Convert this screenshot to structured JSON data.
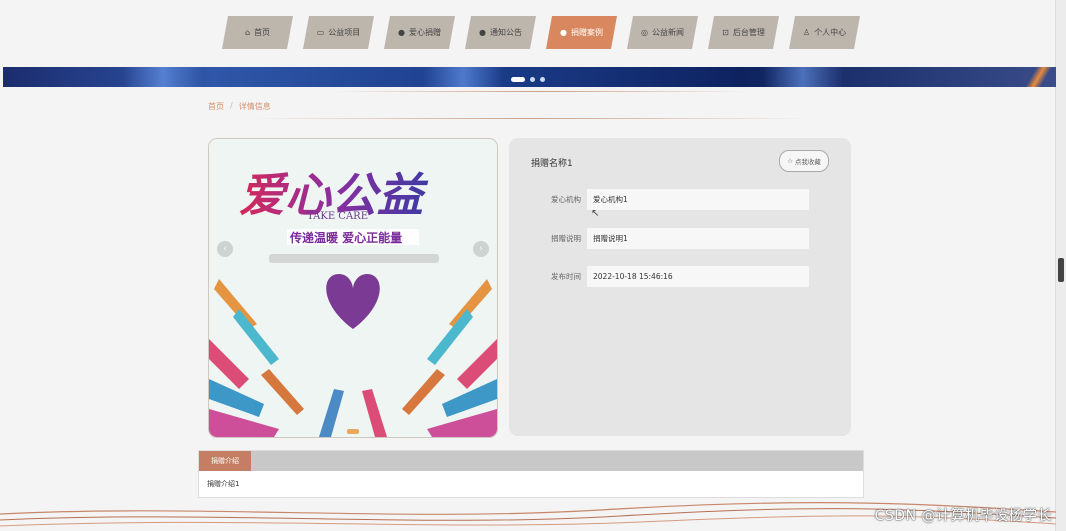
{
  "nav": {
    "items": [
      {
        "label": "首页",
        "icon": "home-icon",
        "active": false
      },
      {
        "label": "公益项目",
        "icon": "briefcase-icon",
        "active": false
      },
      {
        "label": "爱心捐赠",
        "icon": "heart-circle-icon",
        "active": false
      },
      {
        "label": "通知公告",
        "icon": "question-circle-icon",
        "active": false
      },
      {
        "label": "捐赠案例",
        "icon": "info-circle-icon",
        "active": true
      },
      {
        "label": "公益新闻",
        "icon": "globe-icon",
        "active": false
      },
      {
        "label": "后台管理",
        "icon": "settings-box-icon",
        "active": false
      },
      {
        "label": "个人中心",
        "icon": "user-icon",
        "active": false
      }
    ]
  },
  "breadcrumb": {
    "home": "首页",
    "sep": "/",
    "current": "详情信息"
  },
  "detail": {
    "title": "捐赠名称1",
    "favorite_label": "点我收藏",
    "fields": [
      {
        "label": "爱心机构",
        "value": "爱心机构1"
      },
      {
        "label": "捐赠说明",
        "value": "捐赠说明1"
      },
      {
        "label": "发布时间",
        "value": "2022-10-18 15:46:16"
      }
    ]
  },
  "poster": {
    "headline": "爱心公益",
    "sub_en": "TAKE CARE",
    "slogan": "传递温暖 爱心正能量"
  },
  "intro": {
    "tab": "捐赠介绍",
    "content": "捐赠介绍1"
  },
  "watermark": "CSDN @计算机毕设杨学长",
  "colors": {
    "accent": "#d9875e",
    "nav_bg": "#bdb6ad",
    "tab_accent": "#c57d63"
  }
}
